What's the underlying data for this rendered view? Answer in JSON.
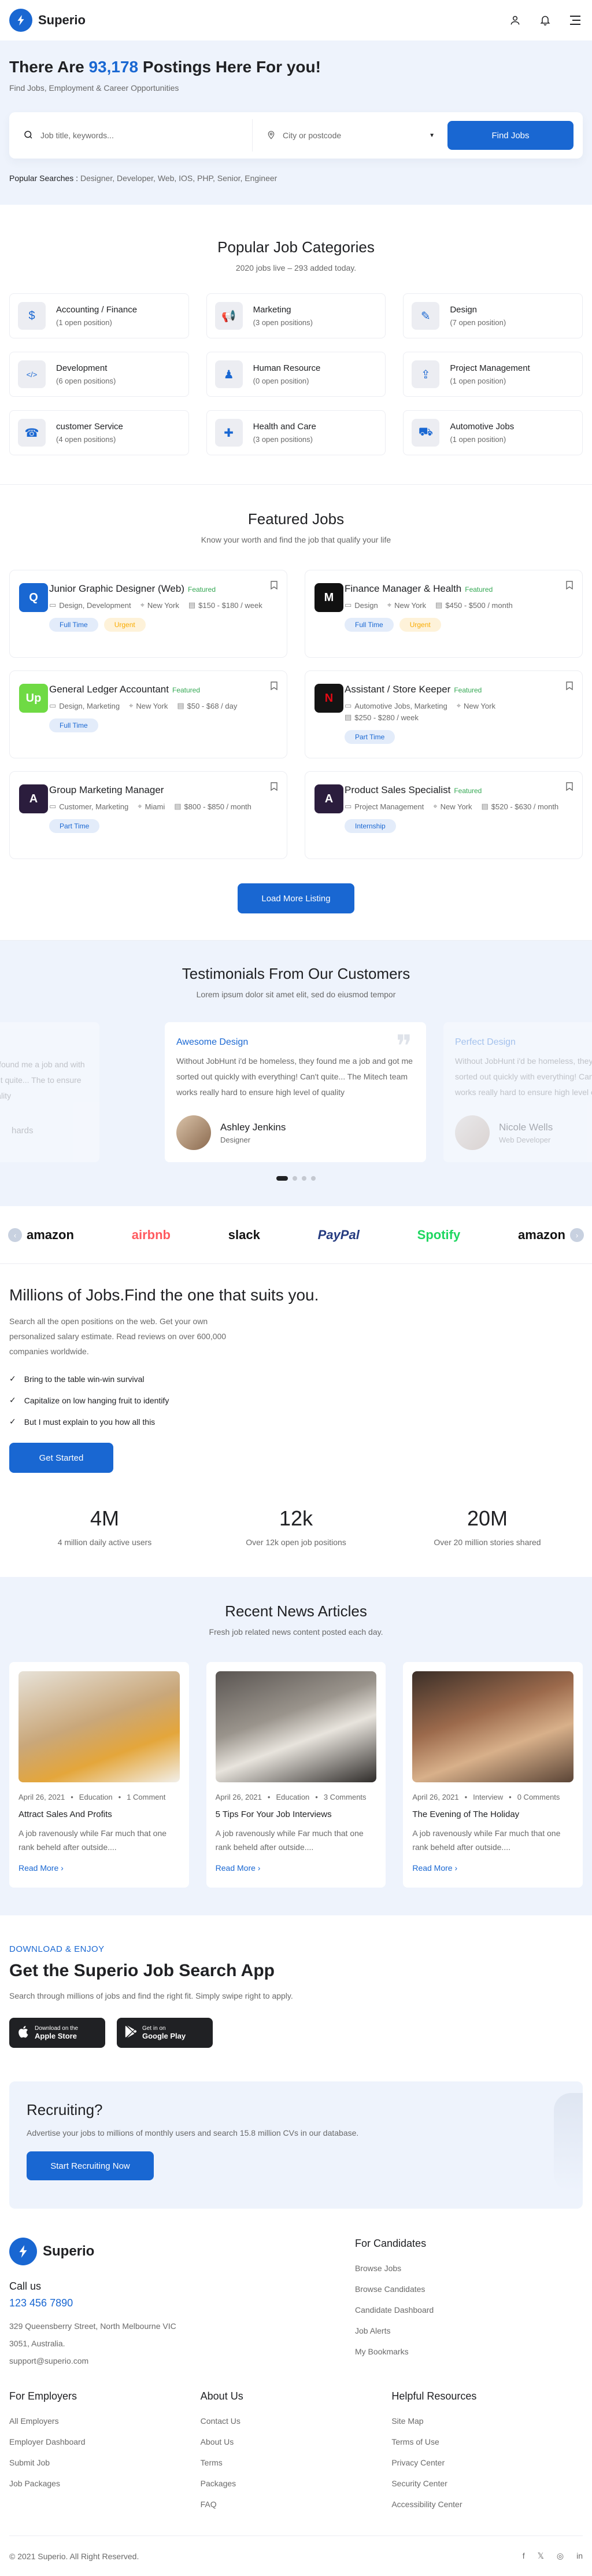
{
  "header": {
    "brand": "Superio"
  },
  "hero": {
    "title_pre": "There Are ",
    "title_count": "93,178",
    "title_post": " Postings Here For you!",
    "subtitle": "Find Jobs, Employment & Career Opportunities",
    "keyword_placeholder": "Job title, keywords...",
    "location_placeholder": "City or postcode",
    "search_button": "Find Jobs",
    "popular_label": "Popular Searches",
    "popular_terms": "Designer, Developer, Web, IOS, PHP, Senior, Engineer"
  },
  "categories": {
    "title": "Popular Job Categories",
    "subtitle": "2020 jobs live – 293 added today.",
    "items": [
      {
        "name": "Accounting / Finance",
        "count": "(1 open position)",
        "icon": "money-icon"
      },
      {
        "name": "Marketing",
        "count": "(3 open positions)",
        "icon": "megaphone-icon"
      },
      {
        "name": "Design",
        "count": "(7 open position)",
        "icon": "vector-icon"
      },
      {
        "name": "Development",
        "count": "(6 open positions)",
        "icon": "code-icon"
      },
      {
        "name": "Human Resource",
        "count": "(0 open position)",
        "icon": "user-tie-icon"
      },
      {
        "name": "Project Management",
        "count": "(1 open position)",
        "icon": "rocket-icon"
      },
      {
        "name": "customer Service",
        "count": "(4 open positions)",
        "icon": "headset-icon"
      },
      {
        "name": "Health and Care",
        "count": "(3 open positions)",
        "icon": "first-aid-icon"
      },
      {
        "name": "Automotive Jobs",
        "count": "(1 open position)",
        "icon": "car-icon"
      }
    ]
  },
  "featured": {
    "title": "Featured Jobs",
    "subtitle": "Know your worth and find the job that qualify your life",
    "featured_label": "Featured",
    "load_more": "Load More Listing",
    "jobs": [
      {
        "title": "Junior Graphic Designer (Web)",
        "featured": true,
        "category": "Design, Development",
        "location": "New York",
        "salary": "$150 - $180 / week",
        "tags": [
          [
            "Full Time",
            "blue"
          ],
          [
            "Urgent",
            "yellow"
          ]
        ],
        "logo": "Q",
        "logo_bg": "#1967d2"
      },
      {
        "title": "Finance Manager & Health",
        "featured": true,
        "category": "Design",
        "location": "New York",
        "salary": "$450 - $500 / month",
        "tags": [
          [
            "Full Time",
            "blue"
          ],
          [
            "Urgent",
            "yellow"
          ]
        ],
        "logo": "M",
        "logo_bg": "#111111"
      },
      {
        "title": "General Ledger Accountant",
        "featured": true,
        "category": "Design, Marketing",
        "location": "New York",
        "salary": "$50 - $68 / day",
        "tags": [
          [
            "Full Time",
            "blue"
          ]
        ],
        "logo": "Up",
        "logo_bg": "#6fda44"
      },
      {
        "title": "Assistant / Store Keeper",
        "featured": true,
        "category": "Automotive Jobs, Marketing",
        "location": "New York",
        "salary": "$250 - $280 / week",
        "tags": [
          [
            "Part Time",
            "blue"
          ]
        ],
        "logo": "N",
        "logo_bg": "#141414"
      },
      {
        "title": "Group Marketing Manager",
        "featured": false,
        "category": "Customer, Marketing",
        "location": "Miami",
        "salary": "$800 - $850 / month",
        "tags": [
          [
            "Part Time",
            "blue"
          ]
        ],
        "logo": "A",
        "logo_bg": "#2b1d3d"
      },
      {
        "title": "Product Sales Specialist",
        "featured": true,
        "category": "Project Management",
        "location": "New York",
        "salary": "$520 - $630 / month",
        "tags": [
          [
            "Internship",
            "blue"
          ]
        ],
        "logo": "A",
        "logo_bg": "#2b1d3d"
      }
    ]
  },
  "testimonials": {
    "title": "Testimonials From Our Customers",
    "subtitle": "Lorem ipsum dolor sit amet elit, sed do eiusmod tempor",
    "left": {
      "text": "homeless, they found me a job and with everything! Can't quite... The to ensure high level of quality",
      "name": "hards"
    },
    "center": {
      "heading": "Awesome Design",
      "text": "Without JobHunt i'd be homeless, they found me a job and got me sorted out quickly with everything! Can't quite... The Mitech team works really hard to ensure high level of quality",
      "name": "Ashley Jenkins",
      "role": "Designer"
    },
    "right": {
      "heading": "Perfect Design",
      "text": "Without JobHunt i'd be homeless, they found me a job and got me sorted out quickly with everything! Can't quite... The Mitech team works really hard to ensure high level of quality",
      "name": "Nicole Wells",
      "role": "Web Developer"
    }
  },
  "brands": [
    {
      "name": "amazon",
      "color": "#111111"
    },
    {
      "name": "airbnb",
      "color": "#ff5a5f"
    },
    {
      "name": "slack",
      "color": "#111111"
    },
    {
      "name": "PayPal",
      "color": "#253b80"
    },
    {
      "name": "Spotify",
      "color": "#1ed760"
    },
    {
      "name": "amazon",
      "color": "#111111"
    }
  ],
  "millions": {
    "title": "Millions of Jobs.Find the one that suits you.",
    "desc": "Search all the open positions on the web. Get your own personalized salary estimate. Read reviews on over 600,000 companies worldwide.",
    "checks": [
      "Bring to the table win-win survival",
      "Capitalize on low hanging fruit to identify",
      "But I must explain to you how all this"
    ],
    "button": "Get Started",
    "stats": [
      {
        "num": "4M",
        "label": "4 million daily active users"
      },
      {
        "num": "12k",
        "label": "Over 12k open job positions"
      },
      {
        "num": "20M",
        "label": "Over 20 million stories shared"
      }
    ]
  },
  "news": {
    "title": "Recent News Articles",
    "subtitle": "Fresh job related news content posted each day.",
    "read_more": "Read More",
    "items": [
      {
        "date": "April 26, 2021",
        "cat": "Education",
        "comments": "1 Comment",
        "title": "Attract Sales And Profits",
        "excerpt": "A job ravenously while Far much that one rank beheld after outside....",
        "img": "linear-gradient(160deg,#e7e2d8 0%,#c9a77a 45%,#e4a63b 70%,#f2efe9 100%)"
      },
      {
        "date": "April 26, 2021",
        "cat": "Education",
        "comments": "3 Comments",
        "title": "5 Tips For Your Job Interviews",
        "excerpt": "A job ravenously while Far much that one rank beheld after outside....",
        "img": "linear-gradient(160deg,#5a5552 0%,#9a948c 40%,#e8e4dd 60%,#2e2b29 100%)"
      },
      {
        "date": "April 26, 2021",
        "cat": "Interview",
        "comments": "0 Comments",
        "title": "The Evening of The Holiday",
        "excerpt": "A job ravenously while Far much that one rank beheld after outside....",
        "img": "linear-gradient(160deg,#3b2f28 0%,#9c6a4c 40%,#d8b08a 65%,#5a4436 100%)"
      }
    ]
  },
  "app": {
    "kicker": "DOWNLOAD & ENJOY",
    "title": "Get the Superio Job Search App",
    "desc": "Search through millions of jobs and find the right fit. Simply swipe right to apply.",
    "apple_small": "Download on the",
    "apple_big": "Apple Store",
    "google_small": "Get in on",
    "google_big": "Google Play"
  },
  "recruit": {
    "title": "Recruiting?",
    "desc": "Advertise your jobs to millions of monthly users and search 15.8 million CVs in our database.",
    "button": "Start Recruiting Now"
  },
  "footer": {
    "brand": "Superio",
    "call_label": "Call us",
    "phone": "123 456 7890",
    "address1": "329 Queensberry Street, North Melbourne VIC",
    "address2": "3051, Australia.",
    "email": "support@superio.com",
    "candidates": {
      "title": "For Candidates",
      "links": [
        "Browse Jobs",
        "Browse Candidates",
        "Candidate Dashboard",
        "Job Alerts",
        "My Bookmarks"
      ]
    },
    "employers": {
      "title": "For Employers",
      "links": [
        "All Employers",
        "Employer Dashboard",
        "Submit Job",
        "Job Packages"
      ]
    },
    "about": {
      "title": "About Us",
      "links": [
        "Contact Us",
        "About Us",
        "Terms",
        "Packages",
        "FAQ"
      ]
    },
    "resources": {
      "title": "Helpful Resources",
      "links": [
        "Site Map",
        "Terms of Use",
        "Privacy Center",
        "Security Center",
        "Accessibility Center"
      ]
    },
    "copyright": "© 2021 Superio. All Right Reserved."
  }
}
